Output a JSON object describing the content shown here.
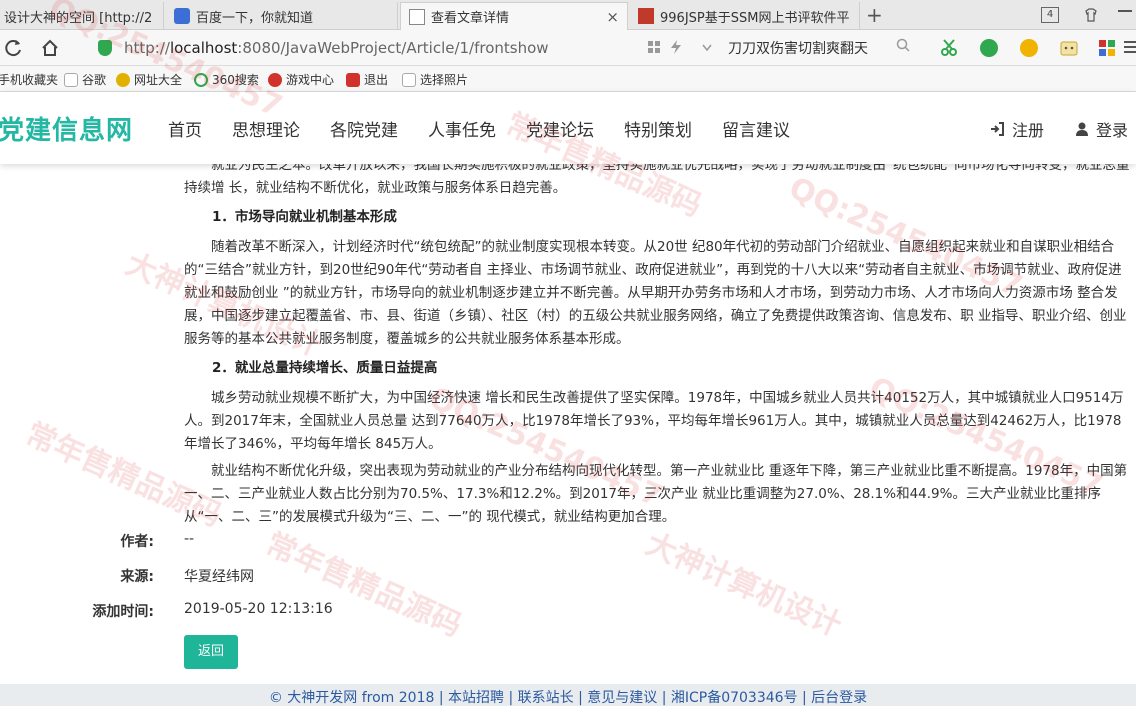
{
  "browser": {
    "tabs": [
      {
        "title": "设计大神的空间 [http://2",
        "favicon_color": "#f0a000"
      },
      {
        "title": "百度一下，你就知道",
        "favicon_color": "#3b6fd6"
      },
      {
        "title": "查看文章详情",
        "favicon_color": "#ffffff"
      },
      {
        "title": "996JSP基于SSM网上书评软件平",
        "favicon_color": "#c0392b"
      }
    ],
    "tab_close": "×",
    "new_tab": "+",
    "tab_count": "4",
    "url_prefix": "http://",
    "url_host": "localhost",
    "url_rest": ":8080/JavaWebProject/Article/1/frontshow",
    "search_text": "刀刀双伤害切割爽翻天",
    "bookmarks": [
      {
        "label": "手机收藏夹",
        "icon_color": "#888888"
      },
      {
        "label": "谷歌",
        "icon_color": "#bbbbbb"
      },
      {
        "label": "网址大全",
        "icon_color": "#e2b100"
      },
      {
        "label": "360搜索",
        "icon_color": "#2fa84f"
      },
      {
        "label": "游戏中心",
        "icon_color": "#d0332b"
      },
      {
        "label": "退出",
        "icon_color": "#d0332b"
      },
      {
        "label": "选择照片",
        "icon_color": "#bbbbbb"
      }
    ]
  },
  "site": {
    "brand": "党建信息网",
    "brand_color": "#23b7a4",
    "nav": [
      "首页",
      "思想理论",
      "各院党建",
      "人事任免",
      "党建论坛",
      "特别策划",
      "留言建议"
    ],
    "register": "注册",
    "login": "登录"
  },
  "article": {
    "intro": "就业为民生之本。改革开放以来，我国长期实施积极的就业政策，坚持实施就业优先战略，实现了劳动就业制度由“统包统配”向市场化导向转变，就业总量持续增 长，就业结构不断优化，就业政策与服务体系日趋完善。",
    "heading1": "1．市场导向就业机制基本形成",
    "para1": "随着改革不断深入，计划经济时代“统包统配”的就业制度实现根本转变。从20世 纪80年代初的劳动部门介绍就业、自愿组织起来就业和自谋职业相结合的“三结合”就业方针，到20世纪90年代“劳动者自 主择业、市场调节就业、政府促进就业”，再到党的十八大以来“劳动者自主就业、市场调节就业、政府促进就业和鼓励创业 ”的就业方针，市场导向的就业机制逐步建立并不断完善。从早期开办劳务市场和人才市场，到劳动力市场、人才市场向人力资源市场 整合发展，中国逐步建立起覆盖省、市、县、街道（乡镇）、社区（村）的五级公共就业服务网络，确立了免费提供政策咨询、信息发布、职 业指导、职业介绍、创业服务等的基本公共就业服务制度，覆盖城乡的公共就业服务体系基本形成。",
    "heading2": "2．就业总量持续增长、质量日益提高",
    "para2": "城乡劳动就业规模不断扩大，为中国经济快速 增长和民生改善提供了坚实保障。1978年，中国城乡就业人员共计40152万人，其中城镇就业人口9514万人。到2017年末，全国就业人员总量 达到77640万人，比1978年增长了93%，平均每年增长961万人。其中，城镇就业人员总量达到42462万人，比1978年增长了346%，平均每年增长 845万人。",
    "para3": "就业结构不断优化升级，突出表现为劳动就业的产业分布结构向现代化转型。第一产业就业比 重逐年下降，第三产业就业比重不断提高。1978年，中国第一、二、三产业就业人数占比分别为70.5%、17.3%和12.2%。到2017年，三次产业 就业比重调整为27.0%、28.1%和44.9%。三大产业就业比重排序从“一、二、三”的发展模式升级为“三、二、一”的 现代模式，就业结构更加合理。"
  },
  "meta": {
    "author_label": "作者:",
    "author_value": "--",
    "source_label": "来源:",
    "source_value": "华夏经纬网",
    "time_label": "添加时间:",
    "time_value": "2019-05-20 12:13:16"
  },
  "back_button": "返回",
  "back_button_color": "#1fb598",
  "footer": "© 大神开发网 from 2018 | 本站招聘 | 联系站长 | 意见与建议 | 湘ICP备0703346号 | 后台登录",
  "watermarks": [
    "QQ:254540457",
    "常年售精品源码",
    "大神计算机设计",
    "QQ:254540457",
    "常年售精品源码",
    "QQ:254540457",
    "大神计算机设计",
    "QQ:254540457",
    "常年售精品源码"
  ]
}
